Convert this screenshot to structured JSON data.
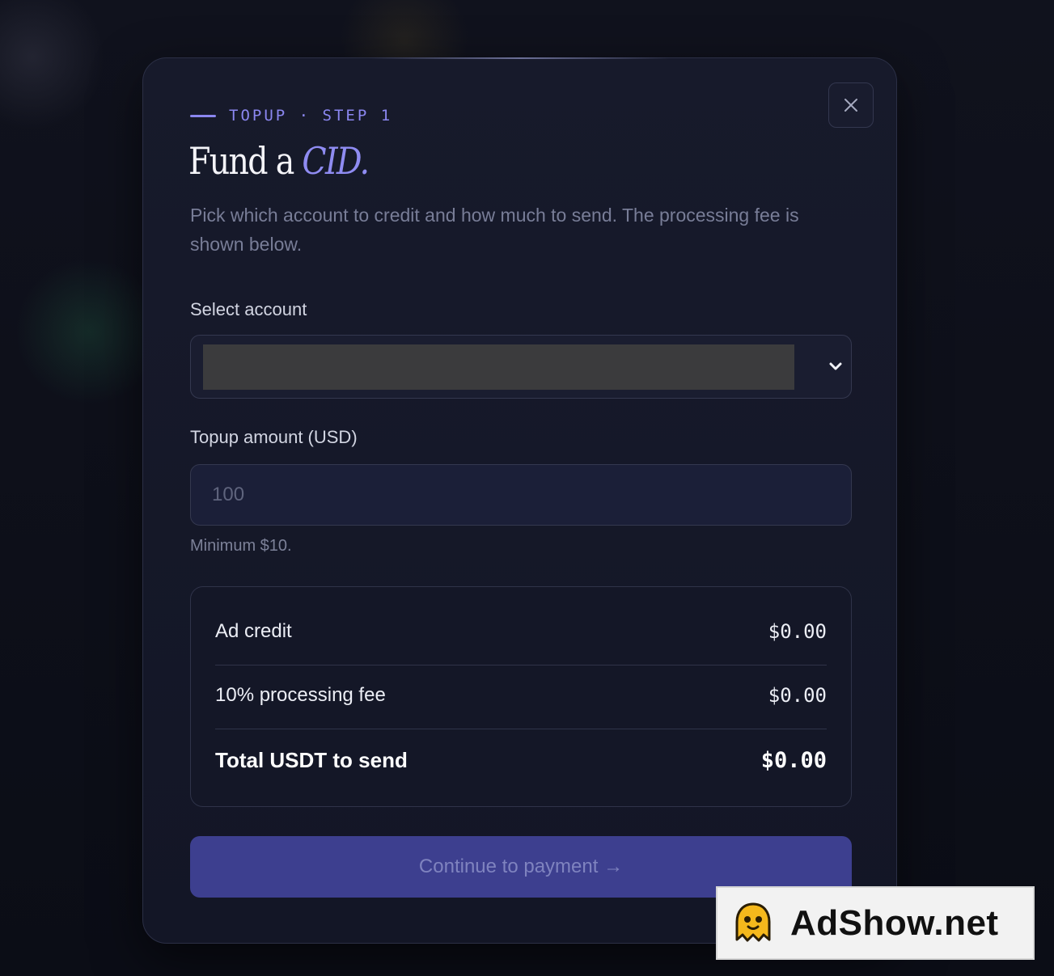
{
  "modal": {
    "eyebrow": "TOPUP · STEP 1",
    "title_main": "Fund a",
    "title_accent": "CID.",
    "subtitle": "Pick which account to credit and how much to send. The processing fee is shown below.",
    "close_icon": "close-icon"
  },
  "account": {
    "label": "Select account",
    "selected_value": "",
    "chevron_icon": "chevron-down-icon"
  },
  "amount": {
    "label": "Topup amount (USD)",
    "placeholder": "100",
    "value": "",
    "hint": "Minimum $10."
  },
  "summary": {
    "rows": [
      {
        "label": "Ad credit",
        "value": "$0.00"
      },
      {
        "label": "10% processing fee",
        "value": "$0.00"
      },
      {
        "label": "Total USDT to send",
        "value": "$0.00"
      }
    ]
  },
  "cta": {
    "label": "Continue to payment →"
  },
  "watermark": {
    "text": "AdShow.net",
    "logo_icon": "ghost-mascot-icon"
  },
  "colors": {
    "accent": "#8b87f0",
    "background": "#0c0e18",
    "modal_bg": "#171a2b",
    "button_bg": "#3d3f8f"
  }
}
